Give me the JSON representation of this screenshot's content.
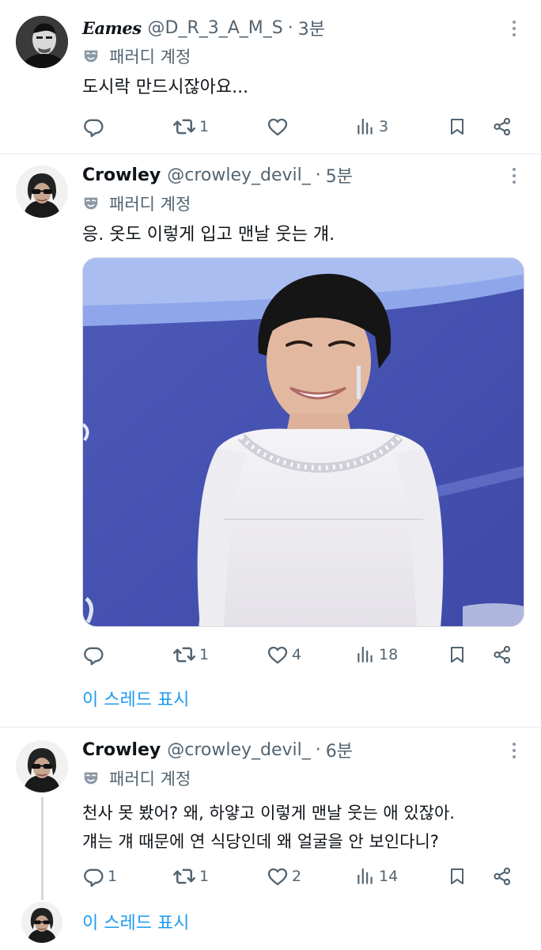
{
  "tweets": [
    {
      "name": "Eames",
      "handle": "@D_R_3_A_M_S",
      "sep": "·",
      "time": "3분",
      "badge": "패러디 계정",
      "text": "도시락 만드시잖아요...",
      "reply_count": "",
      "retweet_count": "1",
      "like_count": "",
      "view_count": "3"
    },
    {
      "name": "Crowley",
      "handle": "@crowley_devil_",
      "sep": "·",
      "time": "5분",
      "badge": "패러디 계정",
      "text": "응. 옷도 이렇게 입고 맨날 웃는 걔.",
      "reply_count": "",
      "retweet_count": "1",
      "like_count": "4",
      "view_count": "18",
      "thread_label": "이 스레드 표시"
    },
    {
      "name": "Crowley",
      "handle": "@crowley_devil_",
      "sep": "·",
      "time": "6분",
      "badge": "패러디 계정",
      "text_lines": [
        "천사 못 봤어? 왜, 하얗고 이렇게 맨날 웃는 애 있잖아.",
        "걔는 걔 때문에 연 식당인데 왜 얼굴을 안 보인다니?"
      ],
      "reply_count": "1",
      "retweet_count": "1",
      "like_count": "2",
      "view_count": "14",
      "thread_label": "이 스레드 표시"
    }
  ],
  "icons": [
    "reply-icon",
    "retweet-icon",
    "like-icon",
    "views-icon",
    "bookmark-icon",
    "share-icon",
    "parody-mask-icon",
    "more-icon"
  ],
  "colors": {
    "text": "#0f1419",
    "secondary": "#536471",
    "link": "#1d9bf0",
    "divider": "#e6e9eb"
  }
}
